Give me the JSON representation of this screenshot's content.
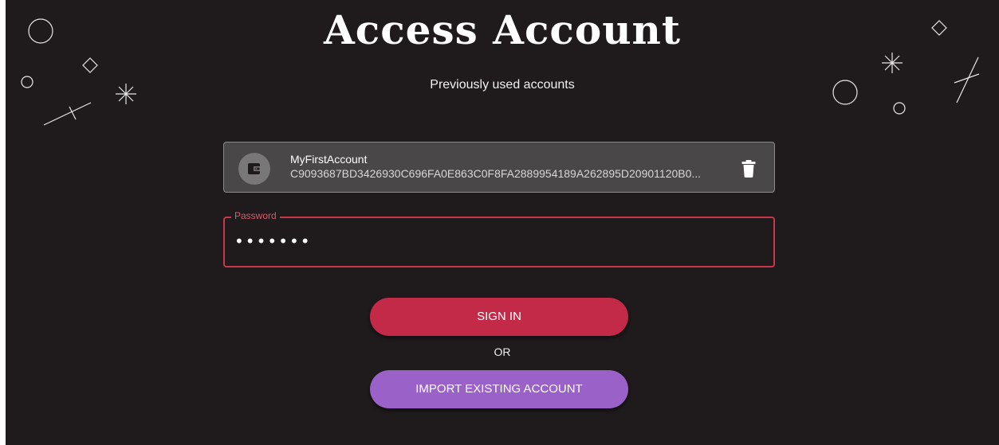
{
  "header": {
    "title": "Access Account",
    "subtitle": "Previously used accounts"
  },
  "accounts": [
    {
      "name": "MyFirstAccount",
      "address": "C9093687BD3426930C696FA0E863C0F8FA2889954189A262895D20901120B0...",
      "icon": "wallet-icon",
      "action_icon": "trash-icon"
    }
  ],
  "password_field": {
    "label": "Password",
    "masked_value": "•••••••"
  },
  "actions": {
    "sign_in_label": "SIGN IN",
    "separator": "OR",
    "import_label": "IMPORT EXISTING ACCOUNT"
  },
  "colors": {
    "background": "#1f1a1c",
    "sign_in": "#c32a48",
    "import": "#9a62c9",
    "field_focus": "#c8374c",
    "card": "#4a4748"
  }
}
